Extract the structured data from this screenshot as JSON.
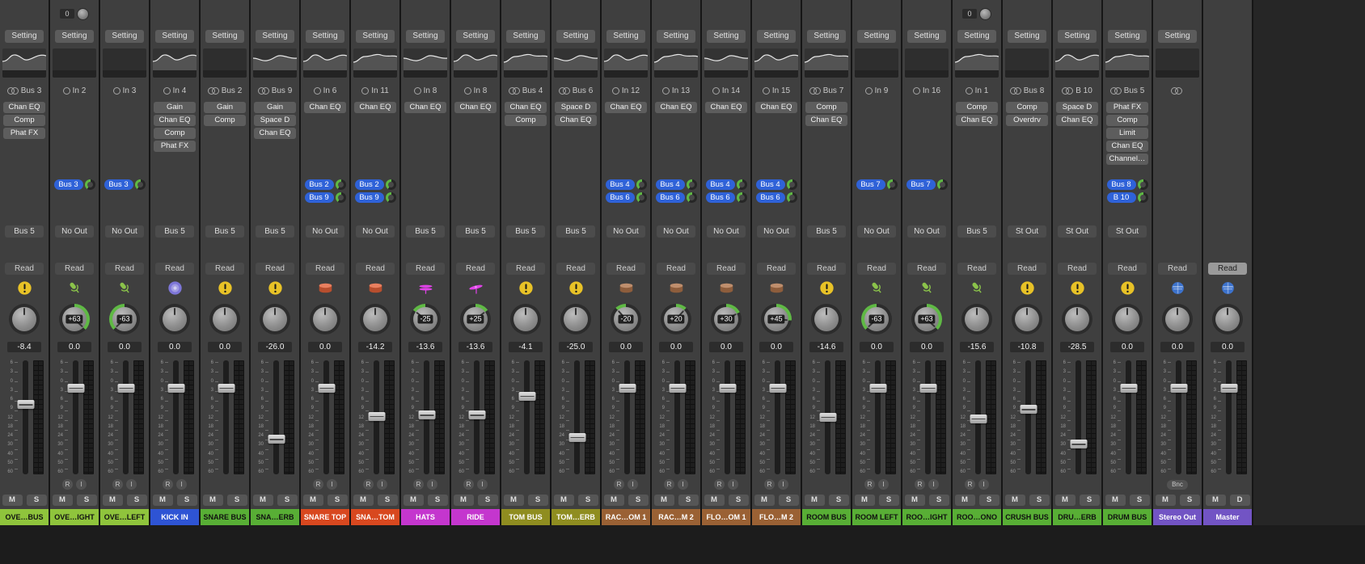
{
  "mixer": {
    "labels": {
      "setting": "Setting",
      "read": "Read",
      "mute": "M",
      "solo": "S",
      "record": "R",
      "input_monitor": "I",
      "bounce": "Bnc"
    },
    "colors": {
      "send_pill": "#2f62d8",
      "pan_arc": "#5fb944",
      "strip_bg": "#3f3f3f"
    },
    "icon_colors": {
      "warning": "#e8c227",
      "mic": "#8bc34a",
      "kick": "#7d76d8",
      "snare": "#e0542a",
      "tom": "#a8683c",
      "hihat": "#e042e8",
      "ride": "#e042e8",
      "stereo": "#3c72cc"
    },
    "scale_ticks": [
      "6",
      "3",
      "0",
      "3",
      "6",
      "9",
      "12",
      "18",
      "24",
      "30",
      "40",
      "50",
      "60"
    ],
    "strips": [
      {
        "name": "OVE…BUS",
        "color": "#8fc43c",
        "fg": "#101010",
        "gain": null,
        "setting": true,
        "eq": "curve",
        "input": {
          "label": "Bus 3",
          "stereo": true
        },
        "inserts": [
          "Chan EQ",
          "Comp",
          "Phat FX"
        ],
        "sends": [],
        "output": "Bus 5",
        "automation_light": false,
        "icon": "warning",
        "pan": 0,
        "pan_label": null,
        "volume": "-8.4",
        "volume_db": -8.4,
        "rec": false,
        "bounce": false,
        "solo": "S"
      },
      {
        "name": "OVE…IGHT",
        "color": "#8fc43c",
        "fg": "#101010",
        "gain": "0",
        "setting": true,
        "eq": "blank",
        "input": {
          "label": "In 2",
          "stereo": false
        },
        "inserts": [],
        "sends": [
          "Bus 3"
        ],
        "output": "No Out",
        "automation_light": false,
        "icon": "mic",
        "pan": 63,
        "pan_label": "+63",
        "volume": "0.0",
        "volume_db": 0,
        "rec": true,
        "bounce": false,
        "solo": "S"
      },
      {
        "name": "OVE…LEFT",
        "color": "#8fc43c",
        "fg": "#101010",
        "gain": null,
        "setting": true,
        "eq": "blank",
        "input": {
          "label": "In 3",
          "stereo": false
        },
        "inserts": [],
        "sends": [
          "Bus 3"
        ],
        "output": "No Out",
        "automation_light": false,
        "icon": "mic",
        "pan": -63,
        "pan_label": "-63",
        "volume": "0.0",
        "volume_db": 0,
        "rec": true,
        "bounce": false,
        "solo": "S"
      },
      {
        "name": "KICK IN",
        "color": "#2e54d4",
        "fg": "#ffffff",
        "gain": null,
        "setting": true,
        "eq": "curve",
        "input": {
          "label": "In 4",
          "stereo": false
        },
        "inserts": [
          "Gain",
          "Chan EQ",
          "Comp",
          "Phat FX"
        ],
        "sends": [],
        "output": "Bus 5",
        "automation_light": false,
        "icon": "kick",
        "pan": 0,
        "pan_label": null,
        "volume": "0.0",
        "volume_db": 0,
        "rec": true,
        "bounce": false,
        "solo": "S"
      },
      {
        "name": "SNARE BUS",
        "color": "#58ae35",
        "fg": "#101010",
        "gain": null,
        "setting": true,
        "eq": "blank",
        "input": {
          "label": "Bus 2",
          "stereo": true
        },
        "inserts": [
          "Gain",
          "Comp"
        ],
        "sends": [],
        "output": "Bus 5",
        "automation_light": false,
        "icon": "warning",
        "pan": 0,
        "pan_label": null,
        "volume": "0.0",
        "volume_db": 0,
        "rec": false,
        "bounce": false,
        "solo": "S"
      },
      {
        "name": "SNA…ERB",
        "color": "#58ae35",
        "fg": "#101010",
        "gain": null,
        "setting": true,
        "eq": "curve",
        "input": {
          "label": "Bus 9",
          "stereo": true
        },
        "inserts": [
          "Gain",
          "Space D",
          "Chan EQ"
        ],
        "sends": [],
        "output": "Bus 5",
        "automation_light": false,
        "icon": "warning",
        "pan": 0,
        "pan_label": null,
        "volume": "-26.0",
        "volume_db": -26,
        "rec": false,
        "bounce": false,
        "solo": "S"
      },
      {
        "name": "SNARE TOP",
        "color": "#d8481f",
        "fg": "#ffffff",
        "gain": null,
        "setting": true,
        "eq": "curve",
        "input": {
          "label": "In 6",
          "stereo": false
        },
        "inserts": [
          "Chan EQ"
        ],
        "sends": [
          "Bus 2",
          "Bus 9"
        ],
        "output": "No Out",
        "automation_light": false,
        "icon": "snare",
        "pan": 0,
        "pan_label": null,
        "volume": "0.0",
        "volume_db": 0,
        "rec": true,
        "bounce": false,
        "solo": "S"
      },
      {
        "name": "SNA…TOM",
        "color": "#d8481f",
        "fg": "#ffffff",
        "gain": null,
        "setting": true,
        "eq": "curve",
        "input": {
          "label": "In 11",
          "stereo": false
        },
        "inserts": [
          "Chan EQ"
        ],
        "sends": [
          "Bus 2",
          "Bus 9"
        ],
        "output": "No Out",
        "automation_light": false,
        "icon": "snare",
        "pan": 0,
        "pan_label": null,
        "volume": "-14.2",
        "volume_db": -14.2,
        "rec": true,
        "bounce": false,
        "solo": "S"
      },
      {
        "name": "HATS",
        "color": "#c436ce",
        "fg": "#ffffff",
        "gain": null,
        "setting": true,
        "eq": "curve",
        "input": {
          "label": "In 8",
          "stereo": false
        },
        "inserts": [
          "Chan EQ"
        ],
        "sends": [],
        "output": "Bus 5",
        "automation_light": false,
        "icon": "hihat",
        "pan": -25,
        "pan_label": "-25",
        "volume": "-13.6",
        "volume_db": -13.6,
        "rec": true,
        "bounce": false,
        "solo": "S"
      },
      {
        "name": "RIDE",
        "color": "#c436ce",
        "fg": "#ffffff",
        "gain": null,
        "setting": true,
        "eq": "curve",
        "input": {
          "label": "In 8",
          "stereo": false
        },
        "inserts": [
          "Chan EQ"
        ],
        "sends": [],
        "output": "Bus 5",
        "automation_light": false,
        "icon": "ride",
        "pan": 25,
        "pan_label": "+25",
        "volume": "-13.6",
        "volume_db": -13.6,
        "rec": true,
        "bounce": false,
        "solo": "S"
      },
      {
        "name": "TOM BUS",
        "color": "#8f8d20",
        "fg": "#ffffff",
        "gain": null,
        "setting": true,
        "eq": "curve",
        "input": {
          "label": "Bus 4",
          "stereo": true
        },
        "inserts": [
          "Chan EQ",
          "Comp"
        ],
        "sends": [],
        "output": "Bus 5",
        "automation_light": false,
        "icon": "warning",
        "pan": 0,
        "pan_label": null,
        "volume": "-4.1",
        "volume_db": -4.1,
        "rec": false,
        "bounce": false,
        "solo": "S"
      },
      {
        "name": "TOM…ERB",
        "color": "#8f8d20",
        "fg": "#ffffff",
        "gain": null,
        "setting": true,
        "eq": "curve",
        "input": {
          "label": "Bus 6",
          "stereo": true
        },
        "inserts": [
          "Space D",
          "Chan EQ"
        ],
        "sends": [],
        "output": "Bus 5",
        "automation_light": false,
        "icon": "warning",
        "pan": 0,
        "pan_label": null,
        "volume": "-25.0",
        "volume_db": -25,
        "rec": false,
        "bounce": false,
        "solo": "S"
      },
      {
        "name": "RAC…OM 1",
        "color": "#9a6134",
        "fg": "#ffffff",
        "gain": null,
        "setting": true,
        "eq": "curve",
        "input": {
          "label": "In 12",
          "stereo": false
        },
        "inserts": [
          "Chan EQ"
        ],
        "sends": [
          "Bus 4",
          "Bus 6"
        ],
        "output": "No Out",
        "automation_light": false,
        "icon": "tom",
        "pan": -20,
        "pan_label": "-20",
        "volume": "0.0",
        "volume_db": 0,
        "rec": true,
        "bounce": false,
        "solo": "S"
      },
      {
        "name": "RAC…M 2",
        "color": "#9a6134",
        "fg": "#ffffff",
        "gain": null,
        "setting": true,
        "eq": "curve",
        "input": {
          "label": "In 13",
          "stereo": false
        },
        "inserts": [
          "Chan EQ"
        ],
        "sends": [
          "Bus 4",
          "Bus 6"
        ],
        "output": "No Out",
        "automation_light": false,
        "icon": "tom",
        "pan": 20,
        "pan_label": "+20",
        "volume": "0.0",
        "volume_db": 0,
        "rec": true,
        "bounce": false,
        "solo": "S"
      },
      {
        "name": "FLO…OM 1",
        "color": "#9a6134",
        "fg": "#ffffff",
        "gain": null,
        "setting": true,
        "eq": "curve",
        "input": {
          "label": "In 14",
          "stereo": false
        },
        "inserts": [
          "Chan EQ"
        ],
        "sends": [
          "Bus 4",
          "Bus 6"
        ],
        "output": "No Out",
        "automation_light": false,
        "icon": "tom",
        "pan": 30,
        "pan_label": "+30",
        "volume": "0.0",
        "volume_db": 0,
        "rec": true,
        "bounce": false,
        "solo": "S"
      },
      {
        "name": "FLO…M 2",
        "color": "#9a6134",
        "fg": "#ffffff",
        "gain": null,
        "setting": true,
        "eq": "curve",
        "input": {
          "label": "In 15",
          "stereo": false
        },
        "inserts": [
          "Chan EQ"
        ],
        "sends": [
          "Bus 4",
          "Bus 6"
        ],
        "output": "No Out",
        "automation_light": false,
        "icon": "tom",
        "pan": 45,
        "pan_label": "+45",
        "volume": "0.0",
        "volume_db": 0,
        "rec": true,
        "bounce": false,
        "solo": "S"
      },
      {
        "name": "ROOM BUS",
        "color": "#58ae35",
        "fg": "#101010",
        "gain": null,
        "setting": true,
        "eq": "curve",
        "input": {
          "label": "Bus 7",
          "stereo": true
        },
        "inserts": [
          "Comp",
          "Chan EQ"
        ],
        "sends": [],
        "output": "Bus 5",
        "automation_light": false,
        "icon": "warning",
        "pan": 0,
        "pan_label": null,
        "volume": "-14.6",
        "volume_db": -14.6,
        "rec": false,
        "bounce": false,
        "solo": "S"
      },
      {
        "name": "ROOM LEFT",
        "color": "#58ae35",
        "fg": "#101010",
        "gain": null,
        "setting": true,
        "eq": "blank",
        "input": {
          "label": "In 9",
          "stereo": false
        },
        "inserts": [],
        "sends": [
          "Bus 7"
        ],
        "output": "No Out",
        "automation_light": false,
        "icon": "mic",
        "pan": -63,
        "pan_label": "-63",
        "volume": "0.0",
        "volume_db": 0,
        "rec": true,
        "bounce": false,
        "solo": "S"
      },
      {
        "name": "ROO…IGHT",
        "color": "#58ae35",
        "fg": "#101010",
        "gain": null,
        "setting": true,
        "eq": "blank",
        "input": {
          "label": "In 16",
          "stereo": false
        },
        "inserts": [],
        "sends": [
          "Bus 7"
        ],
        "output": "No Out",
        "automation_light": false,
        "icon": "mic",
        "pan": 63,
        "pan_label": "+63",
        "volume": "0.0",
        "volume_db": 0,
        "rec": true,
        "bounce": false,
        "solo": "S"
      },
      {
        "name": "ROO…ONO",
        "color": "#58ae35",
        "fg": "#101010",
        "gain": "0",
        "setting": true,
        "eq": "curve",
        "input": {
          "label": "In 1",
          "stereo": false
        },
        "inserts": [
          "Comp",
          "Chan EQ"
        ],
        "sends": [],
        "output": "Bus 5",
        "automation_light": false,
        "icon": "mic",
        "pan": 0,
        "pan_label": null,
        "volume": "-15.6",
        "volume_db": -15.6,
        "rec": true,
        "bounce": false,
        "solo": "S"
      },
      {
        "name": "CRUSH BUS",
        "color": "#58ae35",
        "fg": "#101010",
        "gain": null,
        "setting": true,
        "eq": "blank",
        "input": {
          "label": "Bus 8",
          "stereo": true
        },
        "inserts": [
          "Comp",
          "Overdrv"
        ],
        "sends": [],
        "output": "St Out",
        "automation_light": false,
        "icon": "warning",
        "pan": 0,
        "pan_label": null,
        "volume": "-10.8",
        "volume_db": -10.8,
        "rec": false,
        "bounce": false,
        "solo": "S"
      },
      {
        "name": "DRU…ERB",
        "color": "#58ae35",
        "fg": "#101010",
        "gain": null,
        "setting": true,
        "eq": "curve",
        "input": {
          "label": "B 10",
          "stereo": true
        },
        "inserts": [
          "Space D",
          "Chan EQ"
        ],
        "sends": [],
        "output": "St Out",
        "automation_light": false,
        "icon": "warning",
        "pan": 0,
        "pan_label": null,
        "volume": "-28.5",
        "volume_db": -28.5,
        "rec": false,
        "bounce": false,
        "solo": "S"
      },
      {
        "name": "DRUM BUS",
        "color": "#58ae35",
        "fg": "#101010",
        "gain": null,
        "setting": true,
        "eq": "curve",
        "input": {
          "label": "Bus 5",
          "stereo": true
        },
        "inserts": [
          "Phat FX",
          "Comp",
          "Limit",
          "Chan EQ",
          "Channel…"
        ],
        "sends": [
          "Bus 8",
          "B 10"
        ],
        "output": "St Out",
        "automation_light": false,
        "icon": "warning",
        "pan": 0,
        "pan_label": null,
        "volume": "0.0",
        "volume_db": 0,
        "rec": false,
        "bounce": false,
        "solo": "S"
      },
      {
        "name": "Stereo Out",
        "color": "#7254c4",
        "fg": "#ffffff",
        "gain": null,
        "setting": true,
        "eq": "blank",
        "input": {
          "label": "",
          "stereo": true
        },
        "inserts": [],
        "sends": [],
        "output": null,
        "automation_light": false,
        "icon": "stereo",
        "pan": 0,
        "pan_label": null,
        "volume": "0.0",
        "volume_db": 0,
        "rec": false,
        "bounce": true,
        "solo": "S"
      },
      {
        "name": "Master",
        "color": "#7254c4",
        "fg": "#ffffff",
        "gain": null,
        "setting": false,
        "eq": "none",
        "input": null,
        "inserts": [],
        "sends": [],
        "output": null,
        "automation_light": true,
        "icon": "stereo",
        "pan": 0,
        "pan_label": null,
        "volume": "0.0",
        "volume_db": 0,
        "rec": false,
        "bounce": false,
        "solo": "D"
      }
    ]
  }
}
